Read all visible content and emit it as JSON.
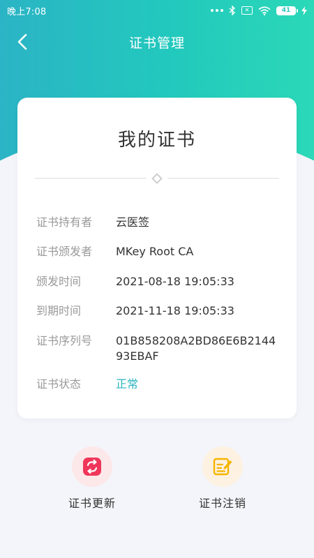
{
  "status_bar": {
    "time": "晚上7:08",
    "battery": "41"
  },
  "nav": {
    "title": "证书管理"
  },
  "card": {
    "title": "我的证书",
    "rows": [
      {
        "label": "证书持有者",
        "value": "云医签"
      },
      {
        "label": "证书颁发者",
        "value": "MKey Root CA"
      },
      {
        "label": "颁发时间",
        "value": "2021-08-18 19:05:33"
      },
      {
        "label": "到期时间",
        "value": "2021-11-18 19:05:33"
      },
      {
        "label": "证书序列号",
        "value": "01B858208A2BD86E6B214493EBAF"
      },
      {
        "label": "证书状态",
        "value": "正常"
      }
    ]
  },
  "actions": {
    "renew_label": "证书更新",
    "revoke_label": "证书注销"
  },
  "colors": {
    "accent": "#22c9bd",
    "status_ok": "#2bb4c0",
    "renew_icon": "#f0365a",
    "revoke_icon": "#f5b400"
  }
}
